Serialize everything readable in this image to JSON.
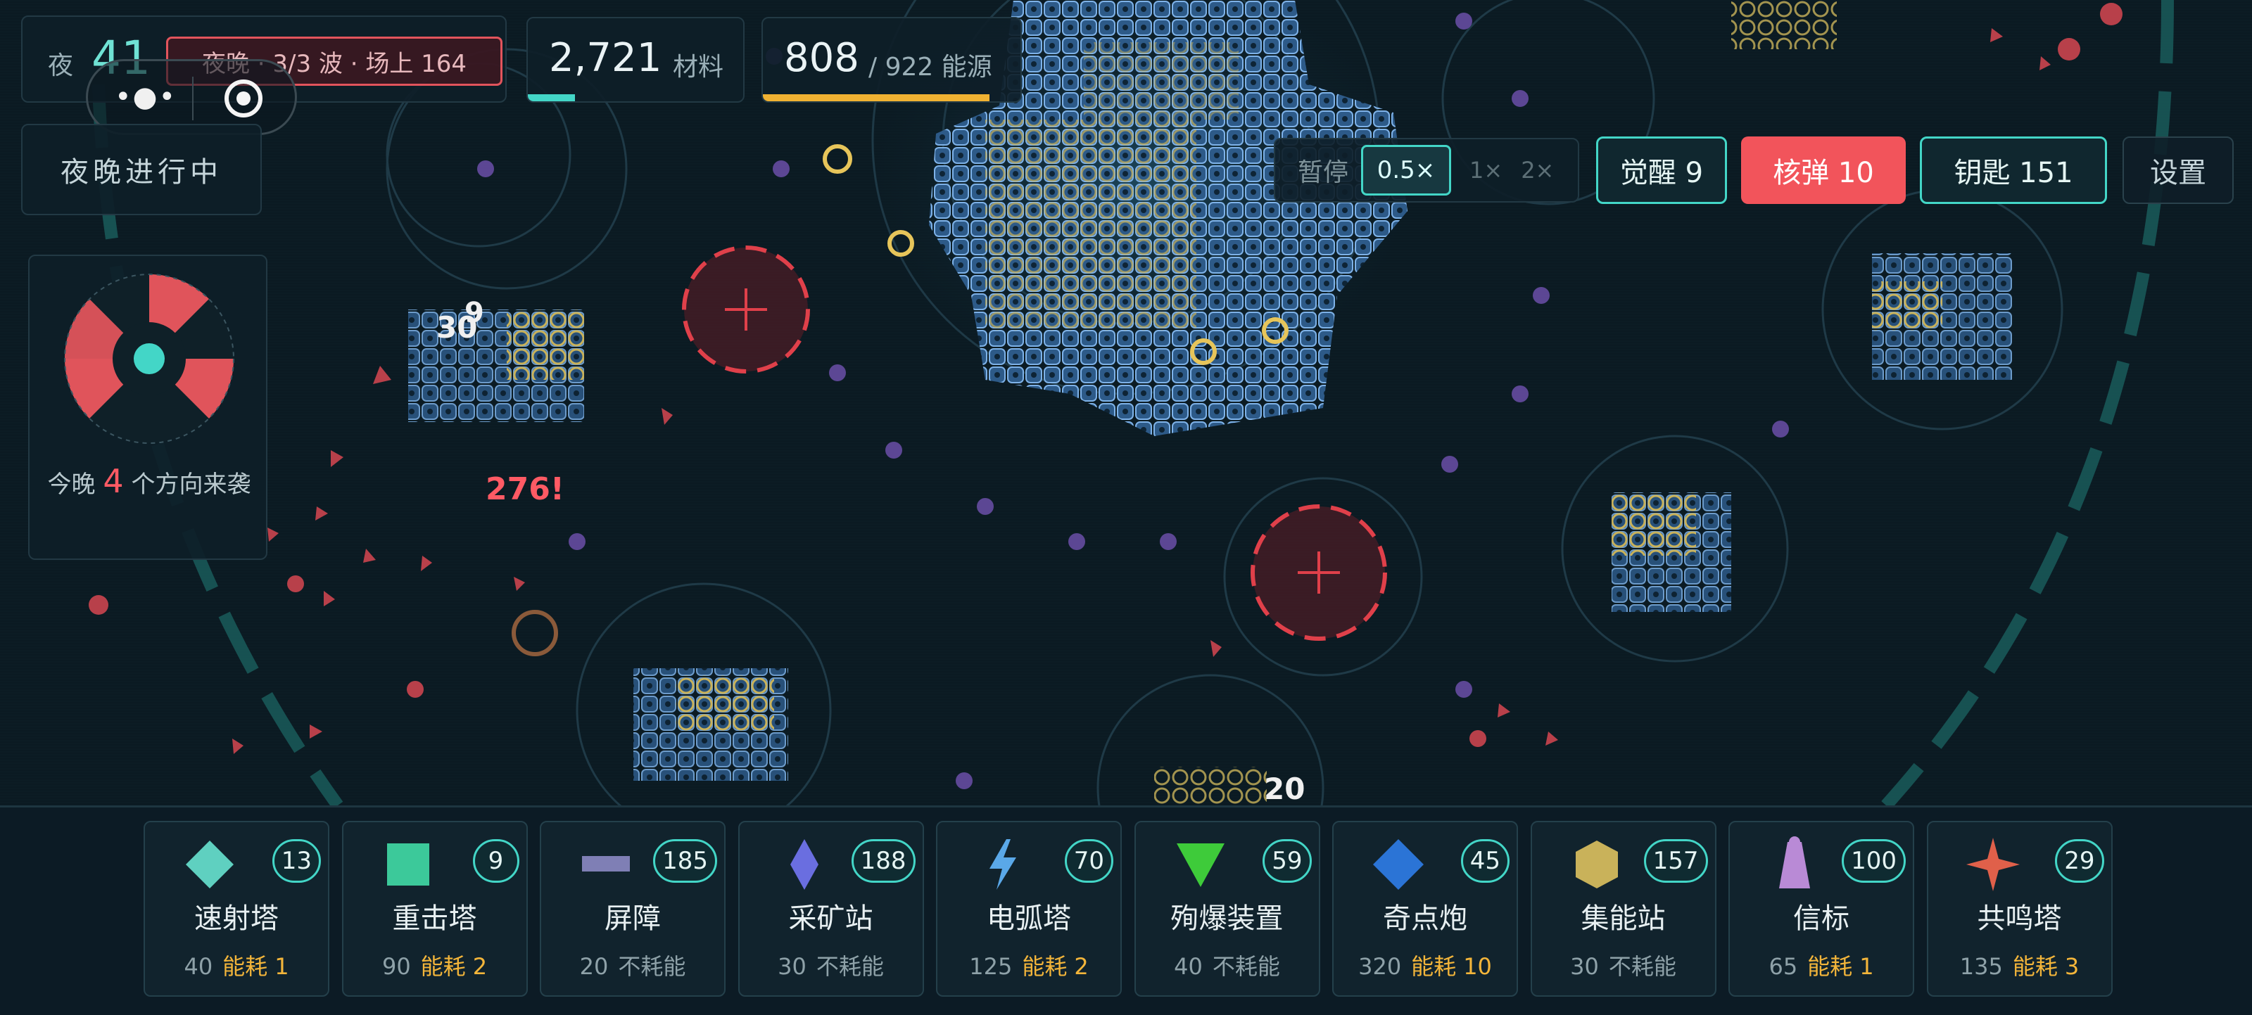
{
  "hud": {
    "night_label": "夜",
    "night_number": "41",
    "wave_info": "夜晚 · 3/3 波 · 场上 164",
    "materials": {
      "value": "2,721",
      "unit": "材料",
      "fill": 0.22
    },
    "energy": {
      "value": "808",
      "unit": "/ 922 能源",
      "fill": 0.88
    },
    "status_label": "夜晚进行中",
    "direction_text_before": "今晚",
    "direction_count": "4",
    "direction_text_after": "个方向来袭"
  },
  "capsule": {
    "more_icon": "more-dots-icon",
    "close_icon": "target-close-icon"
  },
  "speed": {
    "pause_label": "暂停",
    "options": [
      "0.5×",
      "1×",
      "2×"
    ],
    "selected": "0.5×"
  },
  "actions": {
    "awaken_label": "觉醒 9",
    "nuke_label": "核弹 10",
    "key_label": "钥匙 151",
    "settings_label": "设置"
  },
  "field_labels": {
    "damage_1": "30",
    "damage_2": "9",
    "damage_crit": "276!",
    "damage_3": "20"
  },
  "towers": [
    {
      "name": "速射塔",
      "count": "13",
      "cost": "40",
      "energy_label": "能耗",
      "energy": "1",
      "icon": "diamond-icon",
      "color": "#5fd0c0"
    },
    {
      "name": "重击塔",
      "count": "9",
      "cost": "90",
      "energy_label": "能耗",
      "energy": "2",
      "icon": "square-icon",
      "color": "#3cc99a"
    },
    {
      "name": "屏障",
      "count": "185",
      "cost": "20",
      "energy_label": "不耗能",
      "energy": "",
      "icon": "bar-icon",
      "color": "#7f7fb5"
    },
    {
      "name": "采矿站",
      "count": "188",
      "cost": "30",
      "energy_label": "不耗能",
      "energy": "",
      "icon": "crystal-icon",
      "color": "#6a6ee0"
    },
    {
      "name": "电弧塔",
      "count": "70",
      "cost": "125",
      "energy_label": "能耗",
      "energy": "2",
      "icon": "lightning-icon",
      "color": "#5aa8e8"
    },
    {
      "name": "殉爆装置",
      "count": "59",
      "cost": "40",
      "energy_label": "不耗能",
      "energy": "",
      "icon": "triangle-icon",
      "color": "#3ecb3a"
    },
    {
      "name": "奇点炮",
      "count": "45",
      "cost": "320",
      "energy_label": "能耗",
      "energy": "10",
      "icon": "blue-diamond-icon",
      "color": "#2b74d6"
    },
    {
      "name": "集能站",
      "count": "157",
      "cost": "30",
      "energy_label": "不耗能",
      "energy": "",
      "icon": "hexagon-icon",
      "color": "#c9b25a"
    },
    {
      "name": "信标",
      "count": "100",
      "cost": "65",
      "energy_label": "能耗",
      "energy": "1",
      "icon": "beacon-icon",
      "color": "#b98ad6"
    },
    {
      "name": "共鸣塔",
      "count": "29",
      "cost": "135",
      "energy_label": "能耗",
      "energy": "3",
      "icon": "star-icon",
      "color": "#e0604a"
    }
  ]
}
